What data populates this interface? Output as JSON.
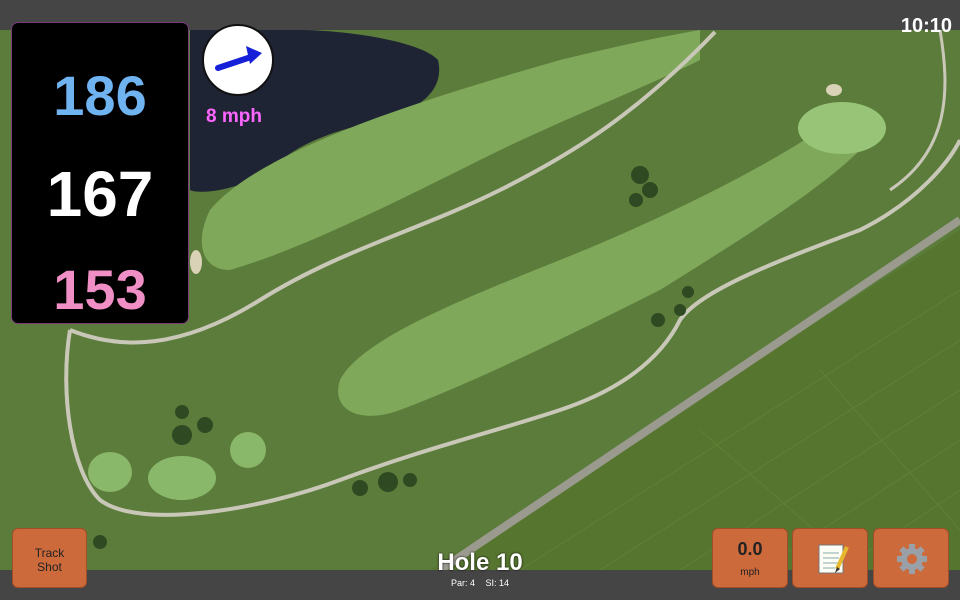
{
  "status_bar": {
    "time": "10:10"
  },
  "yardages": {
    "back": "186",
    "center": "167",
    "front": "153"
  },
  "wind": {
    "speed": "8 mph",
    "direction_icon": "wind-arrow-icon"
  },
  "buttons": {
    "track_shot_label": "Track\nShot",
    "speed_value": "0.0",
    "speed_unit": "mph",
    "notes_icon": "notepad-icon",
    "settings_icon": "gear-icon"
  },
  "hole": {
    "title": "Hole 10",
    "par": "Par: 4",
    "si": "SI: 14"
  },
  "colors": {
    "back_yardage": "#6fb3f0",
    "center_yardage": "#ffffff",
    "front_yardage": "#f08fc6",
    "wind_text": "#ff66ff",
    "button_bg": "#cd6a3c"
  }
}
